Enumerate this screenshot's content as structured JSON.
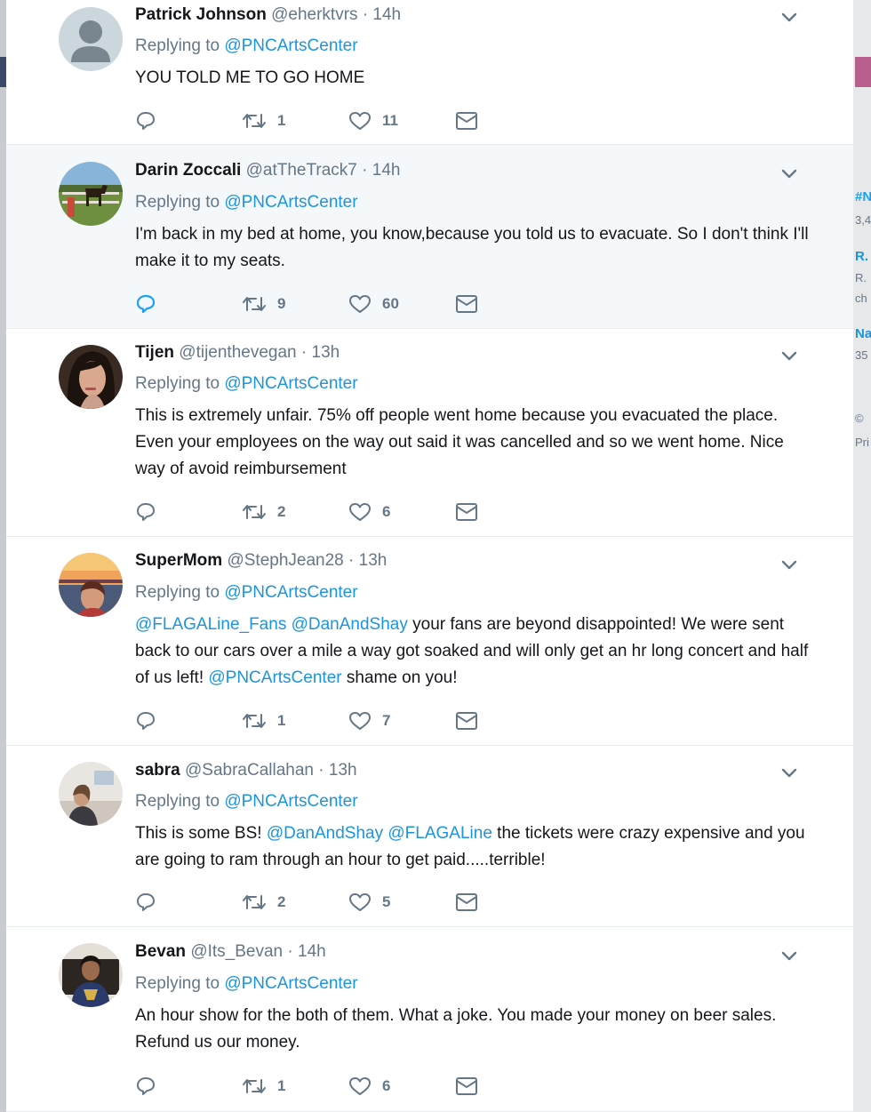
{
  "reply_prefix": "Replying to",
  "colors": {
    "link": "#1b95e0",
    "muted": "#657786",
    "highlight": "#f5f8fa",
    "accent": "#1da1f2"
  },
  "side": {
    "a": "#N",
    "b": "3,4",
    "c": "R.",
    "d": "R.",
    "e": "ch",
    "f": "Na",
    "g": "35",
    "h": "©",
    "i": "Pri"
  },
  "tweets": [
    {
      "name": "Patrick Johnson",
      "handle": "@eherktvrs",
      "time": "14h",
      "reply_to": "@PNCArtsCenter",
      "text_parts": [
        "YOU TOLD ME TO GO HOME"
      ],
      "retweets": "1",
      "likes": "11",
      "highlight": false,
      "reply_active": false,
      "avatar_icon": "default-profile-icon"
    },
    {
      "name": "Darin Zoccali",
      "handle": "@atTheTrack7",
      "time": "14h",
      "reply_to": "@PNCArtsCenter",
      "text_parts": [
        "I'm back in my bed at home, you know,because you told us to evacuate. So I don't think I'll make it to my seats."
      ],
      "retweets": "9",
      "likes": "60",
      "highlight": true,
      "reply_active": true,
      "avatar_icon": "horse-photo"
    },
    {
      "name": "Tijen",
      "handle": "@tijenthevegan",
      "time": "13h",
      "reply_to": "@PNCArtsCenter",
      "text_parts": [
        "This is extremely unfair. 75% off people went home because you evacuated the place. Even your employees on the way out said it was cancelled and so we went home. Nice way of avoid reimbursement"
      ],
      "retweets": "2",
      "likes": "6",
      "highlight": false,
      "reply_active": false,
      "avatar_icon": "portrait-photo"
    },
    {
      "name": "SuperMom",
      "handle": "@StephJean28",
      "time": "13h",
      "reply_to": "@PNCArtsCenter",
      "mentions_a": "@FLAGALine_Fans",
      "mentions_b": "@DanAndShay",
      "text_a": " your fans are beyond disappointed! We were sent back to our cars over a mile a way got soaked and will only get an hr long concert and half of us left! ",
      "mentions_c": "@PNCArtsCenter",
      "text_b": " shame on you!",
      "retweets": "1",
      "likes": "7",
      "highlight": false,
      "reply_active": false,
      "avatar_icon": "sunset-selfie-photo"
    },
    {
      "name": "sabra",
      "handle": "@SabraCallahan",
      "time": "13h",
      "reply_to": "@PNCArtsCenter",
      "text_a": "This is some BS! ",
      "mentions_a": "@DanAndShay",
      "mentions_b": "@FLAGALine",
      "text_b": " the tickets were crazy expensive and you are going to ram through an hour to get paid.....terrible!",
      "retweets": "2",
      "likes": "5",
      "highlight": false,
      "reply_active": false,
      "avatar_icon": "room-photo"
    },
    {
      "name": "Bevan",
      "handle": "@Its_Bevan",
      "time": "14h",
      "reply_to": "@PNCArtsCenter",
      "text_parts": [
        "An hour show for the both of them. What a joke. You made your money on beer sales. Refund us our money."
      ],
      "retweets": "1",
      "likes": "6",
      "highlight": false,
      "reply_active": false,
      "avatar_icon": "man-photo"
    }
  ]
}
